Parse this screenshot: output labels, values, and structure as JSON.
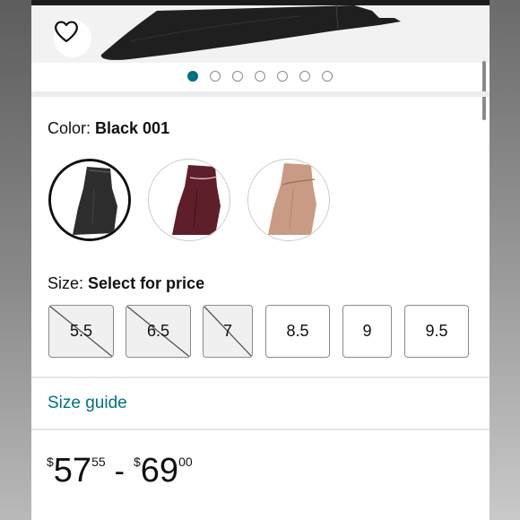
{
  "product": {
    "color_label": "Color: ",
    "color_value": "Black 001",
    "size_label": "Size: ",
    "size_value": "Select for price",
    "swatches": [
      {
        "name": "Black",
        "selected": true,
        "color": "#2a2a2a"
      },
      {
        "name": "Burgundy",
        "selected": false,
        "color": "#5e1f2b"
      },
      {
        "name": "Nude",
        "selected": false,
        "color": "#c99a84"
      }
    ],
    "sizes": [
      {
        "label": "5.5",
        "available": false
      },
      {
        "label": "6.5",
        "available": false
      },
      {
        "label": "7",
        "available": false
      },
      {
        "label": "8.5",
        "available": true
      },
      {
        "label": "9",
        "available": true
      },
      {
        "label": "9.5",
        "available": true
      }
    ],
    "size_guide": "Size guide",
    "price": {
      "low_symbol": "$",
      "low_whole": "57",
      "low_fraction": "55",
      "separator": "-",
      "high_symbol": "$",
      "high_whole": "69",
      "high_fraction": "00"
    }
  },
  "gallery": {
    "dot_count": 7,
    "active_dot": 0
  },
  "colors": {
    "link": "#007185",
    "text": "#0f1111",
    "active_dot": "#007185"
  }
}
